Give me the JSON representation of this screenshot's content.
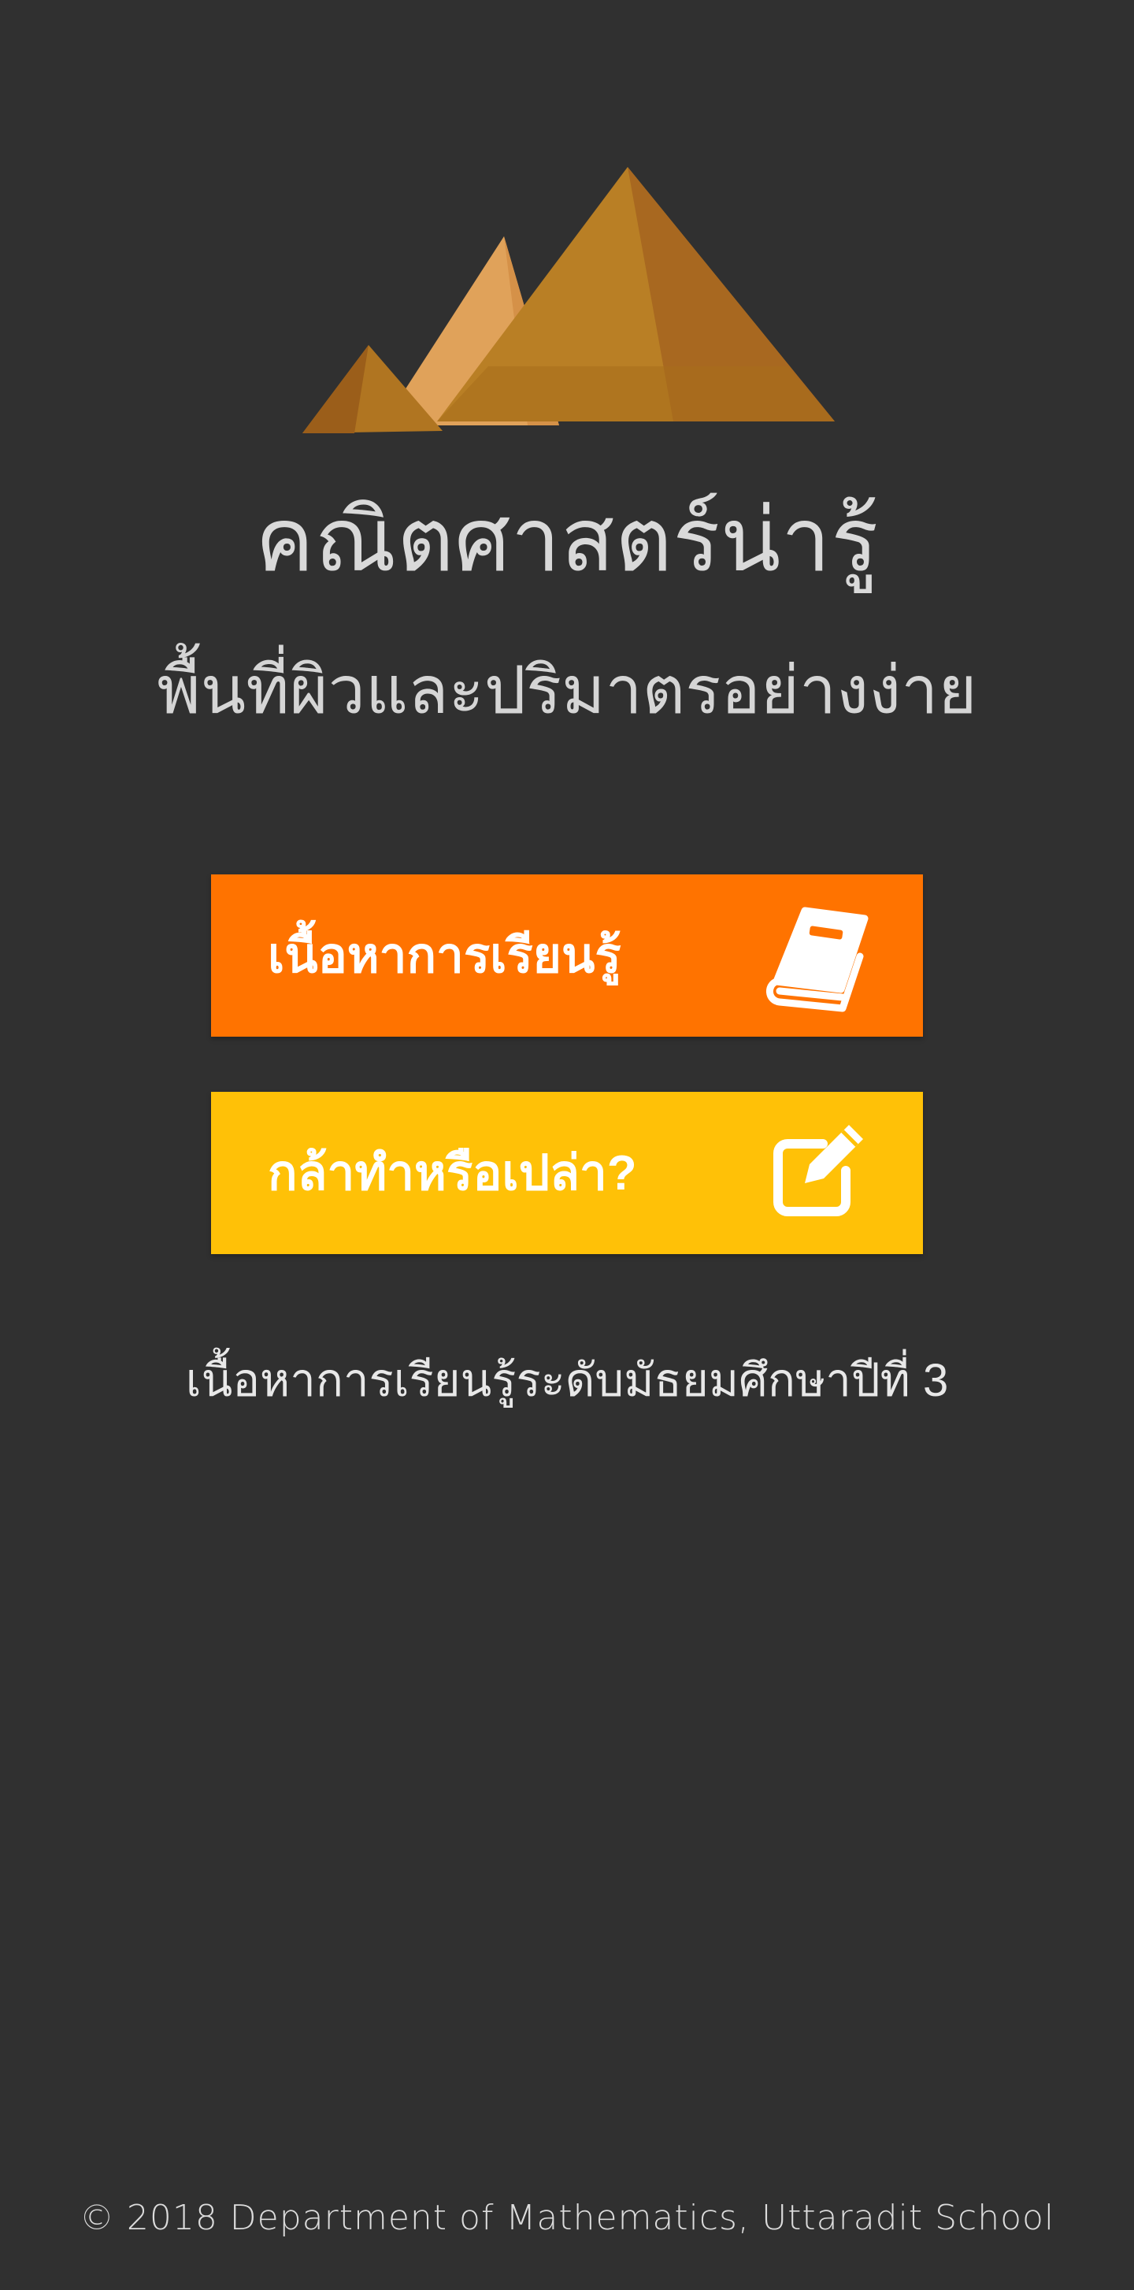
{
  "header": {
    "logo_icon": "pyramids-icon",
    "title": "คณิตศาสตร์น่ารู้",
    "subtitle": "พื้นที่ผิวและปริมาตรอย่างง่าย"
  },
  "menu": {
    "learn": {
      "label": "เนื้อหาการเรียนรู้",
      "icon": "book-icon",
      "color": "#ff7300"
    },
    "quiz": {
      "label": "กล้าทำหรือเปล่า?",
      "icon": "edit-icon",
      "color": "#ffc107"
    }
  },
  "caption": "เนื้อหาการเรียนรู้ระดับมัธยมศึกษาปีที่ 3",
  "footer": "© 2018 Department of Mathematics, Uttaradit School",
  "colors": {
    "background": "#303030",
    "text": "#e6e6e6"
  }
}
